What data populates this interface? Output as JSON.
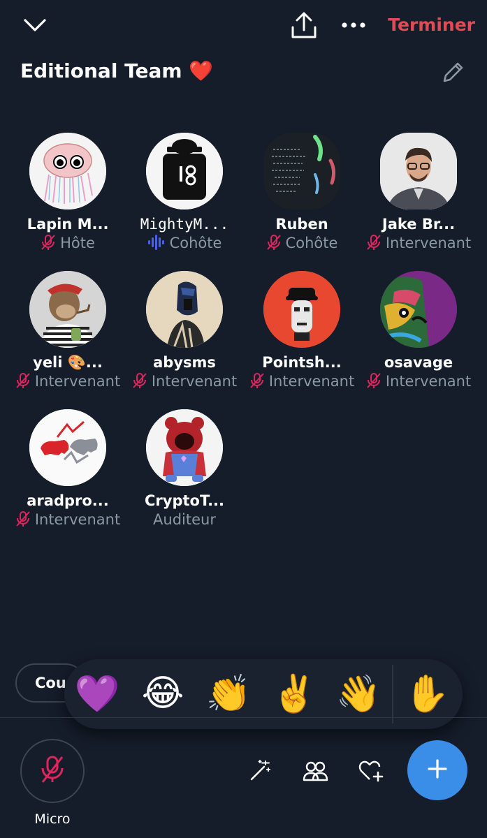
{
  "header": {
    "end_label": "Terminer",
    "title": "Editional Team ❤️",
    "icons": [
      "chevron-down-icon",
      "share-icon",
      "more-icon",
      "pencil-icon"
    ]
  },
  "speakers": [
    {
      "name": "Lapin M...",
      "role": "Hôte",
      "status": "muted"
    },
    {
      "name": "MightyM...",
      "role": "Cohôte",
      "status": "speaking"
    },
    {
      "name": "Ruben",
      "role": "Cohôte",
      "status": "muted"
    },
    {
      "name": "Jake Br...",
      "role": "Intervenant",
      "status": "muted"
    },
    {
      "name": "yeli 🎨...",
      "role": "Intervenant",
      "status": "muted"
    },
    {
      "name": "abysms",
      "role": "Intervenant",
      "status": "muted"
    },
    {
      "name": "Pointsh...",
      "role": "Intervenant",
      "status": "muted"
    },
    {
      "name": "osavage",
      "role": "Intervenant",
      "status": "muted"
    },
    {
      "name": "aradpro...",
      "role": "Intervenant",
      "status": "muted"
    },
    {
      "name": "CryptoT...",
      "role": "Auditeur",
      "status": "listener"
    }
  ],
  "pill": {
    "label": "Cou"
  },
  "reactions": [
    "💜",
    "😂",
    "👏",
    "✌️",
    "👋",
    "✋"
  ],
  "bottom": {
    "mic_label": "Micro",
    "icons": [
      "magic-wand-icon",
      "people-icon",
      "heart-plus-icon",
      "plus-icon"
    ]
  },
  "colors": {
    "background": "#151d2a",
    "end_red": "#e14b55",
    "muted_pink": "#e0245e",
    "speaking_blue": "#4c5fe8",
    "secondary_text": "#8b99a6",
    "fab_blue": "#3b8ee8"
  }
}
